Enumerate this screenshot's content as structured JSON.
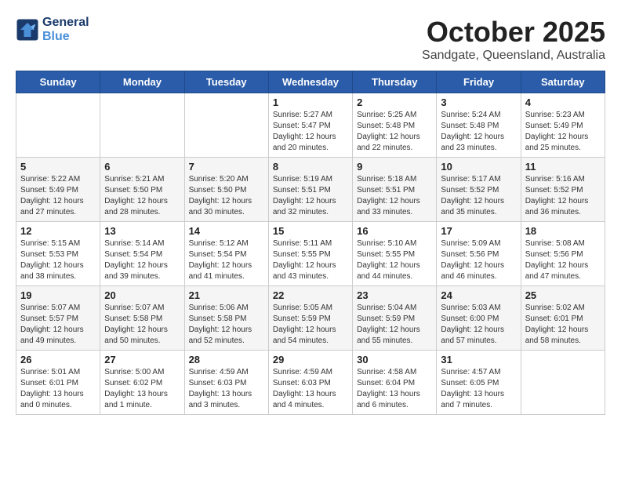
{
  "header": {
    "logo_line1": "General",
    "logo_line2": "Blue",
    "month_title": "October 2025",
    "location": "Sandgate, Queensland, Australia"
  },
  "weekdays": [
    "Sunday",
    "Monday",
    "Tuesday",
    "Wednesday",
    "Thursday",
    "Friday",
    "Saturday"
  ],
  "weeks": [
    [
      {
        "day": "",
        "info": ""
      },
      {
        "day": "",
        "info": ""
      },
      {
        "day": "",
        "info": ""
      },
      {
        "day": "1",
        "info": "Sunrise: 5:27 AM\nSunset: 5:47 PM\nDaylight: 12 hours\nand 20 minutes."
      },
      {
        "day": "2",
        "info": "Sunrise: 5:25 AM\nSunset: 5:48 PM\nDaylight: 12 hours\nand 22 minutes."
      },
      {
        "day": "3",
        "info": "Sunrise: 5:24 AM\nSunset: 5:48 PM\nDaylight: 12 hours\nand 23 minutes."
      },
      {
        "day": "4",
        "info": "Sunrise: 5:23 AM\nSunset: 5:49 PM\nDaylight: 12 hours\nand 25 minutes."
      }
    ],
    [
      {
        "day": "5",
        "info": "Sunrise: 5:22 AM\nSunset: 5:49 PM\nDaylight: 12 hours\nand 27 minutes."
      },
      {
        "day": "6",
        "info": "Sunrise: 5:21 AM\nSunset: 5:50 PM\nDaylight: 12 hours\nand 28 minutes."
      },
      {
        "day": "7",
        "info": "Sunrise: 5:20 AM\nSunset: 5:50 PM\nDaylight: 12 hours\nand 30 minutes."
      },
      {
        "day": "8",
        "info": "Sunrise: 5:19 AM\nSunset: 5:51 PM\nDaylight: 12 hours\nand 32 minutes."
      },
      {
        "day": "9",
        "info": "Sunrise: 5:18 AM\nSunset: 5:51 PM\nDaylight: 12 hours\nand 33 minutes."
      },
      {
        "day": "10",
        "info": "Sunrise: 5:17 AM\nSunset: 5:52 PM\nDaylight: 12 hours\nand 35 minutes."
      },
      {
        "day": "11",
        "info": "Sunrise: 5:16 AM\nSunset: 5:52 PM\nDaylight: 12 hours\nand 36 minutes."
      }
    ],
    [
      {
        "day": "12",
        "info": "Sunrise: 5:15 AM\nSunset: 5:53 PM\nDaylight: 12 hours\nand 38 minutes."
      },
      {
        "day": "13",
        "info": "Sunrise: 5:14 AM\nSunset: 5:54 PM\nDaylight: 12 hours\nand 39 minutes."
      },
      {
        "day": "14",
        "info": "Sunrise: 5:12 AM\nSunset: 5:54 PM\nDaylight: 12 hours\nand 41 minutes."
      },
      {
        "day": "15",
        "info": "Sunrise: 5:11 AM\nSunset: 5:55 PM\nDaylight: 12 hours\nand 43 minutes."
      },
      {
        "day": "16",
        "info": "Sunrise: 5:10 AM\nSunset: 5:55 PM\nDaylight: 12 hours\nand 44 minutes."
      },
      {
        "day": "17",
        "info": "Sunrise: 5:09 AM\nSunset: 5:56 PM\nDaylight: 12 hours\nand 46 minutes."
      },
      {
        "day": "18",
        "info": "Sunrise: 5:08 AM\nSunset: 5:56 PM\nDaylight: 12 hours\nand 47 minutes."
      }
    ],
    [
      {
        "day": "19",
        "info": "Sunrise: 5:07 AM\nSunset: 5:57 PM\nDaylight: 12 hours\nand 49 minutes."
      },
      {
        "day": "20",
        "info": "Sunrise: 5:07 AM\nSunset: 5:58 PM\nDaylight: 12 hours\nand 50 minutes."
      },
      {
        "day": "21",
        "info": "Sunrise: 5:06 AM\nSunset: 5:58 PM\nDaylight: 12 hours\nand 52 minutes."
      },
      {
        "day": "22",
        "info": "Sunrise: 5:05 AM\nSunset: 5:59 PM\nDaylight: 12 hours\nand 54 minutes."
      },
      {
        "day": "23",
        "info": "Sunrise: 5:04 AM\nSunset: 5:59 PM\nDaylight: 12 hours\nand 55 minutes."
      },
      {
        "day": "24",
        "info": "Sunrise: 5:03 AM\nSunset: 6:00 PM\nDaylight: 12 hours\nand 57 minutes."
      },
      {
        "day": "25",
        "info": "Sunrise: 5:02 AM\nSunset: 6:01 PM\nDaylight: 12 hours\nand 58 minutes."
      }
    ],
    [
      {
        "day": "26",
        "info": "Sunrise: 5:01 AM\nSunset: 6:01 PM\nDaylight: 13 hours\nand 0 minutes."
      },
      {
        "day": "27",
        "info": "Sunrise: 5:00 AM\nSunset: 6:02 PM\nDaylight: 13 hours\nand 1 minute."
      },
      {
        "day": "28",
        "info": "Sunrise: 4:59 AM\nSunset: 6:03 PM\nDaylight: 13 hours\nand 3 minutes."
      },
      {
        "day": "29",
        "info": "Sunrise: 4:59 AM\nSunset: 6:03 PM\nDaylight: 13 hours\nand 4 minutes."
      },
      {
        "day": "30",
        "info": "Sunrise: 4:58 AM\nSunset: 6:04 PM\nDaylight: 13 hours\nand 6 minutes."
      },
      {
        "day": "31",
        "info": "Sunrise: 4:57 AM\nSunset: 6:05 PM\nDaylight: 13 hours\nand 7 minutes."
      },
      {
        "day": "",
        "info": ""
      }
    ]
  ]
}
